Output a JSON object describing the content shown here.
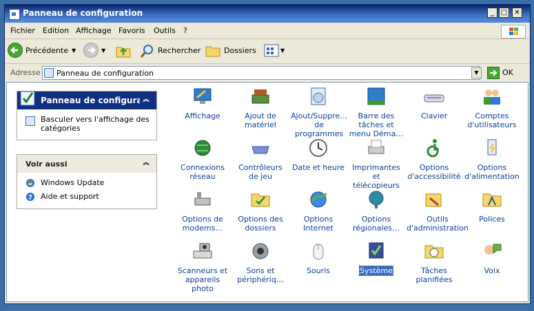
{
  "window": {
    "title": "Panneau de configuration"
  },
  "menus": [
    "Fichier",
    "Edition",
    "Affichage",
    "Favoris",
    "Outils",
    "?"
  ],
  "toolbar": {
    "back_label": "Précédente",
    "search_label": "Rechercher",
    "folders_label": "Dossiers"
  },
  "address": {
    "label": "Adresse",
    "value": "Panneau de configuration",
    "go_label": "OK"
  },
  "tasks_panel": {
    "title": "Panneau de configuratior",
    "switch_label": "Basculer vers l'affichage des catégories"
  },
  "see_also": {
    "title": "Voir aussi",
    "items": [
      "Windows Update",
      "Aide et support"
    ]
  },
  "items": [
    {
      "label": "Affichage",
      "icon": "display-icon"
    },
    {
      "label": "Ajout de matériel",
      "icon": "add-hardware-icon"
    },
    {
      "label": "Ajout/Suppre… de programmes",
      "icon": "add-remove-programs-icon"
    },
    {
      "label": "Barre des tâches et menu Déma…",
      "icon": "taskbar-icon"
    },
    {
      "label": "Clavier",
      "icon": "keyboard-icon"
    },
    {
      "label": "Comptes d'utilisateurs",
      "icon": "user-accounts-icon"
    },
    {
      "label": "Connexions réseau",
      "icon": "network-connections-icon"
    },
    {
      "label": "Contrôleurs de jeu",
      "icon": "game-controller-icon"
    },
    {
      "label": "Date et heure",
      "icon": "date-time-icon"
    },
    {
      "label": "Imprimantes et télécopieurs",
      "icon": "printer-icon"
    },
    {
      "label": "Options d'accessibilité",
      "icon": "accessibility-icon"
    },
    {
      "label": "Options d'alimentation",
      "icon": "power-options-icon"
    },
    {
      "label": "Options de modems…",
      "icon": "modem-icon"
    },
    {
      "label": "Options des dossiers",
      "icon": "folder-options-icon"
    },
    {
      "label": "Options Internet",
      "icon": "internet-options-icon"
    },
    {
      "label": "Options régionales…",
      "icon": "regional-options-icon"
    },
    {
      "label": "Outils d'administration",
      "icon": "admin-tools-icon"
    },
    {
      "label": "Polices",
      "icon": "fonts-icon"
    },
    {
      "label": "Scanneurs et appareils photo",
      "icon": "scanner-camera-icon"
    },
    {
      "label": "Sons et périphériq…",
      "icon": "sounds-icon"
    },
    {
      "label": "Souris",
      "icon": "mouse-icon"
    },
    {
      "label": "Système",
      "icon": "system-icon",
      "selected": true
    },
    {
      "label": "Tâches planifiées",
      "icon": "scheduled-tasks-icon"
    },
    {
      "label": "Voix",
      "icon": "speech-icon"
    }
  ]
}
